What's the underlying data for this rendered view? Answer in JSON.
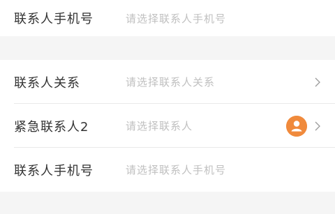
{
  "top_section": {
    "phone_label": "联系人手机号",
    "phone_placeholder": "请选择联系人手机号"
  },
  "emergency_contact_2": {
    "relation_label": "联系人关系",
    "relation_placeholder": "请选择联系人关系",
    "contact_label": "紧急联系人2",
    "contact_placeholder": "请选择联系人",
    "phone_label": "联系人手机号",
    "phone_placeholder": "请选择联系人手机号"
  },
  "colors": {
    "accent": "#f08a3c",
    "label": "#333333",
    "placeholder": "#c0c0c0",
    "background": "#f5f5f5"
  },
  "icons": {
    "chevron": "chevron-right-icon",
    "contact_picker": "person-icon"
  }
}
